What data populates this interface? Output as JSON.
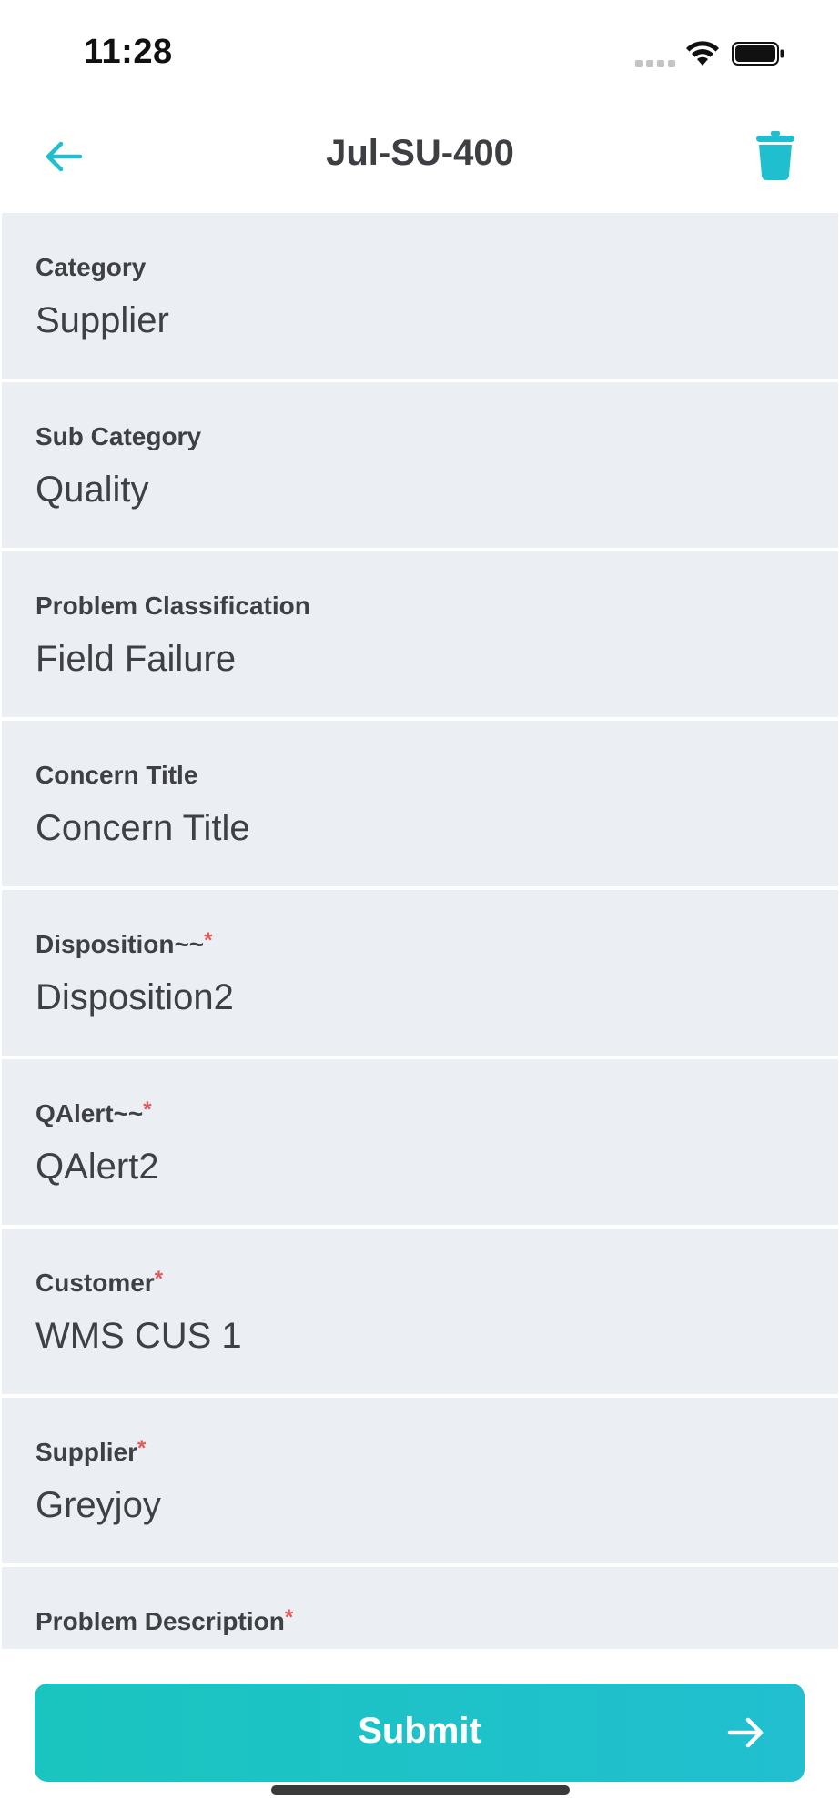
{
  "status_bar": {
    "time": "11:28",
    "icons": [
      "signal-icon",
      "wifi-icon",
      "battery-icon"
    ]
  },
  "header": {
    "title": "Jul-SU-400",
    "back_icon": "arrow-left-icon",
    "delete_icon": "trash-icon"
  },
  "colors": {
    "accent": "#1fbfcf",
    "field_background": "#ebeff4",
    "required": "#e25a5a",
    "text": "#3e4043"
  },
  "fields": [
    {
      "label": "Category",
      "required": "",
      "value": "Supplier"
    },
    {
      "label": "Sub Category",
      "required": "",
      "value": "Quality"
    },
    {
      "label": "Problem Classification",
      "required": "",
      "value": "Field Failure"
    },
    {
      "label": "Concern Title",
      "required": "",
      "value": "Concern Title"
    },
    {
      "label": "Disposition~~",
      "required": "*",
      "value": "Disposition2"
    },
    {
      "label": "QAlert~~",
      "required": "*",
      "value": "QAlert2"
    },
    {
      "label": "Customer",
      "required": "*",
      "value": "WMS CUS 1"
    },
    {
      "label": "Supplier",
      "required": "*",
      "value": "Greyjoy"
    },
    {
      "label": "Problem Description",
      "required": "*",
      "value": ""
    }
  ],
  "submit": {
    "label": "Submit",
    "icon": "arrow-right-icon"
  }
}
